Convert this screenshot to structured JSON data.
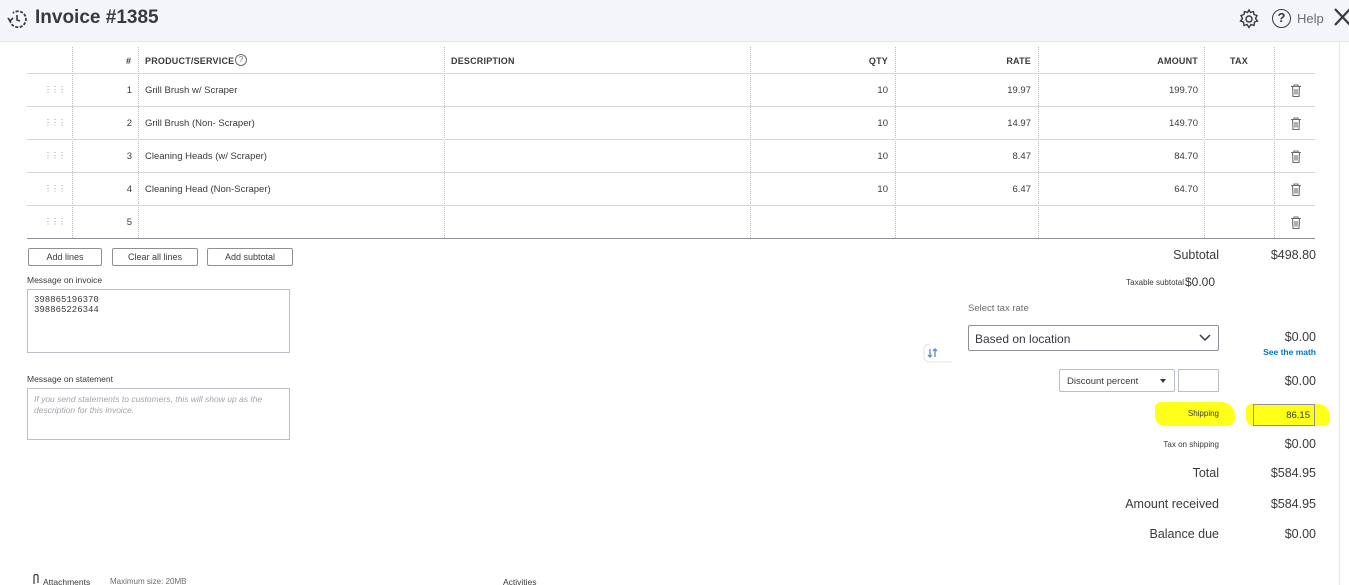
{
  "header": {
    "title": "Invoice #1385",
    "help_label": "Help"
  },
  "table": {
    "headers": {
      "num": "#",
      "product": "PRODUCT/SERVICE",
      "description": "DESCRIPTION",
      "qty": "QTY",
      "rate": "RATE",
      "amount": "AMOUNT",
      "tax": "TAX"
    },
    "rows": [
      {
        "num": "1",
        "product": "Grill Brush w/ Scraper",
        "qty": "10",
        "rate": "19.97",
        "amount": "199.70"
      },
      {
        "num": "2",
        "product": "Grill Brush (Non- Scraper)",
        "qty": "10",
        "rate": "14.97",
        "amount": "149.70"
      },
      {
        "num": "3",
        "product": "Cleaning Heads (w/ Scraper)",
        "qty": "10",
        "rate": "8.47",
        "amount": "84.70"
      },
      {
        "num": "4",
        "product": "Cleaning Head (Non-Scraper)",
        "qty": "10",
        "rate": "6.47",
        "amount": "64.70"
      },
      {
        "num": "5",
        "product": "",
        "qty": "",
        "rate": "",
        "amount": ""
      }
    ]
  },
  "buttons": {
    "add_lines": "Add lines",
    "clear_all_lines": "Clear all lines",
    "add_subtotal": "Add subtotal"
  },
  "message_on_invoice": {
    "label": "Message on invoice",
    "value": "398865196370\n398865226344"
  },
  "message_on_statement": {
    "label": "Message on statement",
    "placeholder": "If you send statements to customers, this will show up as the description for this invoice."
  },
  "totals": {
    "subtotal_label": "Subtotal",
    "subtotal_value": "$498.80",
    "taxable_subtotal_label": "Taxable subtotal",
    "taxable_subtotal_value": "$0.00",
    "select_tax_rate_label": "Select tax rate",
    "tax_rate_selected": "Based on location",
    "tax_value": "$0.00",
    "see_math": "See the math",
    "discount_type": "Discount percent",
    "discount_value": "$0.00",
    "shipping_label": "Shipping",
    "shipping_value": "86.15",
    "tax_on_shipping_label": "Tax on shipping",
    "tax_on_shipping_value": "$0.00",
    "total_label": "Total",
    "total_value": "$584.95",
    "amount_received_label": "Amount received",
    "amount_received_value": "$584.95",
    "balance_due_label": "Balance due",
    "balance_due_value": "$0.00"
  },
  "footer": {
    "attachments_label": "Attachments",
    "max_size": "Maximum size: 20MB",
    "activities_label": "Activities"
  },
  "colors": {
    "highlight": "#ffff1a",
    "link": "#0077c5",
    "header_bg": "#f4f5f8"
  }
}
